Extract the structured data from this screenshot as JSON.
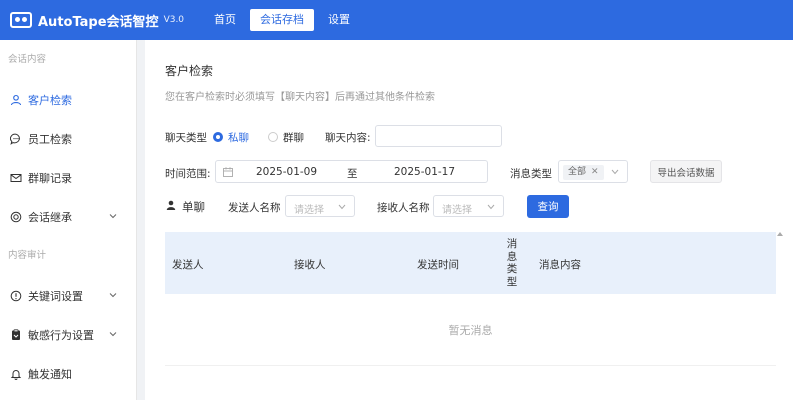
{
  "app": {
    "title": "AutoTape会话智控",
    "version": "V3.0"
  },
  "nav": [
    {
      "label": "首页",
      "active": false
    },
    {
      "label": "会话存档",
      "active": true
    },
    {
      "label": "设置",
      "active": false
    }
  ],
  "sidebar": {
    "group1": "会话内容",
    "group2": "内容审计",
    "items": [
      {
        "label": "客户检索",
        "icon": "user-icon",
        "active": true
      },
      {
        "label": "员工检索",
        "icon": "chat-bubble-icon",
        "active": false
      },
      {
        "label": "群聊记录",
        "icon": "mail-icon",
        "active": false
      },
      {
        "label": "会话继承",
        "icon": "inherit-icon",
        "active": false,
        "expandable": true
      },
      {
        "label": "关键词设置",
        "icon": "info-circle-icon",
        "active": false,
        "expandable": true
      },
      {
        "label": "敏感行为设置",
        "icon": "clipboard-icon",
        "active": false,
        "expandable": true
      },
      {
        "label": "触发通知",
        "icon": "bell-icon",
        "active": false
      }
    ]
  },
  "main": {
    "title": "客户检索",
    "hint": "您在客户检索时必须填写【聊天内容】后再通过其他条件检索",
    "chat_type_label": "聊天类型",
    "radio_private": "私聊",
    "radio_group": "群聊",
    "content_label": "聊天内容:",
    "content_value": "",
    "time_label": "时间范围:",
    "date_start": "2025-01-09",
    "date_to": "至",
    "date_end": "2025-01-17",
    "msg_type_label": "消息类型",
    "msg_type_tag": "全部",
    "export_button": "导出会话数据",
    "section_label": "单聊",
    "sender_label": "发送人名称",
    "sender_placeholder": "请选择",
    "receiver_label": "接收人名称",
    "receiver_placeholder": "请选择",
    "search_button": "查询"
  },
  "table": {
    "columns": [
      "发送人",
      "接收人",
      "发送时间",
      "消息类型",
      "消息内容"
    ],
    "msg_type_chars": [
      "消",
      "息",
      "类",
      "型"
    ],
    "empty_text": "暂无消息"
  },
  "colors": {
    "primary": "#2d6ae0",
    "header_bg": "#e8f0fb"
  }
}
